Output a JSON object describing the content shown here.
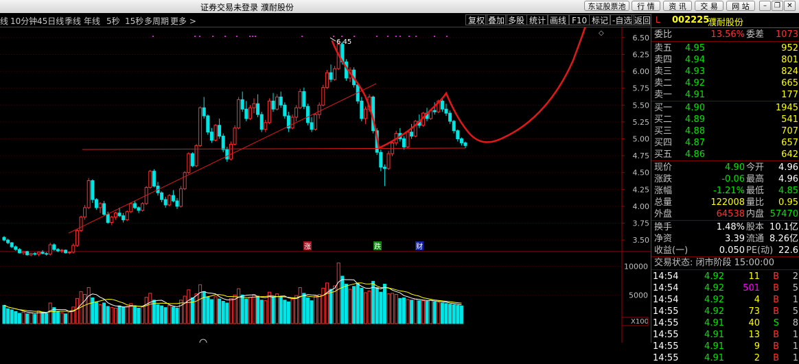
{
  "titlebar": {
    "title": "证券交易未登录  濮耐股份",
    "buttons": [
      "东证股票池",
      "行 情",
      "资 讯",
      "交 易",
      "网 站"
    ]
  },
  "toolbar": {
    "partial": "线",
    "periods": [
      "10分钟",
      "45日线",
      "季线",
      "年线",
      "5秒",
      "15秒",
      "多周期",
      "更多 >"
    ],
    "right_buttons": [
      "复权",
      "叠加",
      "多股",
      "统计",
      "画线",
      "F10",
      "标记",
      "-自选",
      "返回"
    ]
  },
  "chart_data": [
    {
      "type": "candlestick",
      "title": "",
      "y_ticks": [
        3.5,
        3.75,
        4.0,
        4.25,
        4.5,
        4.75,
        5.0,
        5.25,
        5.5,
        5.75,
        6.0,
        6.25,
        6.5
      ],
      "ylim": [
        3.4,
        6.6
      ],
      "annotations": {
        "max_label": "6.45",
        "event_markers": [
          "涨",
          "跌",
          "财"
        ]
      },
      "ohlc": [
        [
          3.54,
          3.56,
          3.48,
          3.5
        ],
        [
          3.5,
          3.52,
          3.44,
          3.46
        ],
        [
          3.46,
          3.47,
          3.38,
          3.4
        ],
        [
          3.4,
          3.42,
          3.34,
          3.36
        ],
        [
          3.36,
          3.38,
          3.3,
          3.31
        ],
        [
          3.31,
          3.34,
          3.28,
          3.33
        ],
        [
          3.33,
          3.34,
          3.27,
          3.28
        ],
        [
          3.28,
          3.31,
          3.26,
          3.3
        ],
        [
          3.3,
          3.32,
          3.27,
          3.29
        ],
        [
          3.29,
          3.33,
          3.26,
          3.32
        ],
        [
          3.32,
          3.35,
          3.29,
          3.3
        ],
        [
          3.3,
          3.32,
          3.27,
          3.29
        ],
        [
          3.29,
          3.46,
          3.27,
          3.43
        ],
        [
          3.43,
          3.45,
          3.34,
          3.36
        ],
        [
          3.36,
          3.38,
          3.32,
          3.34
        ],
        [
          3.34,
          3.37,
          3.31,
          3.35
        ],
        [
          3.35,
          3.36,
          3.3,
          3.31
        ],
        [
          3.31,
          3.33,
          3.29,
          3.32
        ],
        [
          3.32,
          3.45,
          3.3,
          3.42
        ],
        [
          3.42,
          3.66,
          3.4,
          3.64
        ],
        [
          3.64,
          3.86,
          3.62,
          3.84
        ],
        [
          3.84,
          4.02,
          3.8,
          3.98
        ],
        [
          3.98,
          4.42,
          3.96,
          4.38
        ],
        [
          4.38,
          4.4,
          4.05,
          4.1
        ],
        [
          4.1,
          4.12,
          3.95,
          3.98
        ],
        [
          3.98,
          4.06,
          3.9,
          4.04
        ],
        [
          4.04,
          4.08,
          3.86,
          3.88
        ],
        [
          3.88,
          3.92,
          3.74,
          3.76
        ],
        [
          3.76,
          3.86,
          3.72,
          3.84
        ],
        [
          3.84,
          3.92,
          3.8,
          3.9
        ],
        [
          3.9,
          3.98,
          3.84,
          3.86
        ],
        [
          3.86,
          3.9,
          3.76,
          3.8
        ],
        [
          3.8,
          3.94,
          3.78,
          3.92
        ],
        [
          3.92,
          4.06,
          3.9,
          4.04
        ],
        [
          4.04,
          4.08,
          3.96,
          3.98
        ],
        [
          3.98,
          4.0,
          3.9,
          3.94
        ],
        [
          3.94,
          4.06,
          3.92,
          4.04
        ],
        [
          4.04,
          4.3,
          4.02,
          4.28
        ],
        [
          4.28,
          4.54,
          4.26,
          4.52
        ],
        [
          4.52,
          4.55,
          4.28,
          4.3
        ],
        [
          4.3,
          4.36,
          4.16,
          4.2
        ],
        [
          4.2,
          4.22,
          4.06,
          4.1
        ],
        [
          4.1,
          4.14,
          3.98,
          4.02
        ],
        [
          4.02,
          4.18,
          4.0,
          4.16
        ],
        [
          4.16,
          4.24,
          4.06,
          4.08
        ],
        [
          4.08,
          4.12,
          3.96,
          4.0
        ],
        [
          4.0,
          4.3,
          3.98,
          4.26
        ],
        [
          4.26,
          4.52,
          4.24,
          4.5
        ],
        [
          4.5,
          4.8,
          4.48,
          4.78
        ],
        [
          4.78,
          4.8,
          4.58,
          4.6
        ],
        [
          4.6,
          4.92,
          4.58,
          4.9
        ],
        [
          4.9,
          5.48,
          4.88,
          5.46
        ],
        [
          5.46,
          5.62,
          5.3,
          5.34
        ],
        [
          5.34,
          5.36,
          5.06,
          5.1
        ],
        [
          5.1,
          5.16,
          4.94,
          4.98
        ],
        [
          4.98,
          5.22,
          4.96,
          5.2
        ],
        [
          5.2,
          5.3,
          5.0,
          5.04
        ],
        [
          5.04,
          5.08,
          4.8,
          4.84
        ],
        [
          4.84,
          4.88,
          4.66,
          4.7
        ],
        [
          4.7,
          4.96,
          4.68,
          4.92
        ],
        [
          4.92,
          5.2,
          4.9,
          5.16
        ],
        [
          5.16,
          5.62,
          5.14,
          5.58
        ],
        [
          5.58,
          5.7,
          5.4,
          5.44
        ],
        [
          5.44,
          5.56,
          5.26,
          5.3
        ],
        [
          5.3,
          5.5,
          5.28,
          5.46
        ],
        [
          5.46,
          5.6,
          5.38,
          5.52
        ],
        [
          5.52,
          5.66,
          5.32,
          5.36
        ],
        [
          5.36,
          5.4,
          5.1,
          5.14
        ],
        [
          5.14,
          5.28,
          5.1,
          5.24
        ],
        [
          5.24,
          5.6,
          5.22,
          5.56
        ],
        [
          5.56,
          5.68,
          5.4,
          5.44
        ],
        [
          5.44,
          5.66,
          5.42,
          5.62
        ],
        [
          5.62,
          5.7,
          5.46,
          5.5
        ],
        [
          5.5,
          5.54,
          5.3,
          5.34
        ],
        [
          5.34,
          5.4,
          5.1,
          5.16
        ],
        [
          5.16,
          5.36,
          5.14,
          5.32
        ],
        [
          5.32,
          5.5,
          5.26,
          5.46
        ],
        [
          5.46,
          5.74,
          5.44,
          5.7
        ],
        [
          5.7,
          5.76,
          5.44,
          5.48
        ],
        [
          5.48,
          5.52,
          5.2,
          5.24
        ],
        [
          5.24,
          5.32,
          5.1,
          5.14
        ],
        [
          5.14,
          5.38,
          5.12,
          5.36
        ],
        [
          5.36,
          5.54,
          5.3,
          5.5
        ],
        [
          5.5,
          5.8,
          5.48,
          5.76
        ],
        [
          5.76,
          6.02,
          5.74,
          5.98
        ],
        [
          5.98,
          6.1,
          5.84,
          5.88
        ],
        [
          5.88,
          6.08,
          5.86,
          6.04
        ],
        [
          6.04,
          6.46,
          6.02,
          6.4
        ],
        [
          6.4,
          6.44,
          6.1,
          6.14
        ],
        [
          6.14,
          6.18,
          5.86,
          5.9
        ],
        [
          5.9,
          6.06,
          5.84,
          6.02
        ],
        [
          6.02,
          6.06,
          5.76,
          5.8
        ],
        [
          5.8,
          5.84,
          5.52,
          5.56
        ],
        [
          5.56,
          5.62,
          5.26,
          5.3
        ],
        [
          5.3,
          5.48,
          5.22,
          5.44
        ],
        [
          5.44,
          5.66,
          5.4,
          5.62
        ],
        [
          5.62,
          5.64,
          5.08,
          5.12
        ],
        [
          5.12,
          5.16,
          4.76,
          4.8
        ],
        [
          4.8,
          4.84,
          4.52,
          4.58
        ],
        [
          4.58,
          4.62,
          4.3,
          4.56
        ],
        [
          4.56,
          4.82,
          4.54,
          4.78
        ],
        [
          4.78,
          4.98,
          4.74,
          4.94
        ],
        [
          4.94,
          5.12,
          4.9,
          5.08
        ],
        [
          5.08,
          5.16,
          4.96,
          5.0
        ],
        [
          5.0,
          5.04,
          4.84,
          4.88
        ],
        [
          4.88,
          5.12,
          4.86,
          5.1
        ],
        [
          5.1,
          5.22,
          5.0,
          5.04
        ],
        [
          5.04,
          5.28,
          5.02,
          5.26
        ],
        [
          5.26,
          5.36,
          5.16,
          5.2
        ],
        [
          5.2,
          5.4,
          5.18,
          5.38
        ],
        [
          5.38,
          5.46,
          5.26,
          5.3
        ],
        [
          5.3,
          5.44,
          5.28,
          5.42
        ],
        [
          5.42,
          5.54,
          5.36,
          5.4
        ],
        [
          5.4,
          5.58,
          5.38,
          5.56
        ],
        [
          5.56,
          5.6,
          5.4,
          5.44
        ],
        [
          5.44,
          5.52,
          5.34,
          5.38
        ],
        [
          5.38,
          5.42,
          5.22,
          5.26
        ],
        [
          5.26,
          5.28,
          5.08,
          5.12
        ],
        [
          5.12,
          5.14,
          4.96,
          5.0
        ],
        [
          5.0,
          5.02,
          4.9,
          4.94
        ],
        [
          4.94,
          4.96,
          4.86,
          4.9
        ]
      ],
      "volume_y_ticks": [
        5000,
        10000
      ],
      "volume_multiplier": "X100",
      "volume": [
        3200,
        2600,
        2400,
        2100,
        1800,
        2000,
        1700,
        1900,
        1600,
        2200,
        2000,
        1800,
        3600,
        2800,
        2100,
        1900,
        1700,
        2000,
        2900,
        4400,
        5600,
        5100,
        6300,
        4500,
        3800,
        3300,
        3600,
        3000,
        2800,
        2700,
        3100,
        2900,
        3000,
        3500,
        3100,
        2700,
        2900,
        4600,
        5300,
        4100,
        3300,
        3100,
        2800,
        3200,
        2900,
        2700,
        4100,
        4800,
        5900,
        4500,
        5200,
        6800,
        5600,
        4700,
        4200,
        4700,
        4300,
        3900,
        3600,
        4400,
        5000,
        6100,
        5000,
        4300,
        4600,
        5100,
        4800,
        4100,
        4000,
        5500,
        4700,
        5200,
        4600,
        4100,
        3800,
        4300,
        4900,
        6300,
        5300,
        4500,
        4000,
        4800,
        5100,
        6200,
        7100,
        6000,
        6600,
        10600,
        8300,
        6900,
        6000,
        6500,
        7000,
        6200,
        5400,
        5700,
        7400,
        6300,
        5500,
        6900,
        5200,
        5300,
        5100,
        4400,
        4500,
        4200,
        4100,
        4300,
        4000,
        4000,
        3900,
        4100,
        3800,
        3700,
        3600,
        3500,
        3400,
        3300,
        3200,
        3100
      ]
    }
  ],
  "quote_panel": {
    "header": {
      "code": "002225",
      "name": "濮耐股份",
      "mark": "L"
    },
    "weibi": {
      "label": "委比",
      "value": "13.56%",
      "label2": "委差",
      "value2": "1073"
    },
    "sell": [
      {
        "label": "卖五",
        "price": "4.95",
        "vol": "952"
      },
      {
        "label": "卖四",
        "price": "4.94",
        "vol": "801"
      },
      {
        "label": "卖三",
        "price": "4.93",
        "vol": "824"
      },
      {
        "label": "卖二",
        "price": "4.92",
        "vol": "665"
      },
      {
        "label": "卖一",
        "price": "4.91",
        "vol": "177"
      }
    ],
    "buy": [
      {
        "label": "买一",
        "price": "4.90",
        "vol": "1945"
      },
      {
        "label": "买二",
        "price": "4.89",
        "vol": "541"
      },
      {
        "label": "买三",
        "price": "4.88",
        "vol": "707"
      },
      {
        "label": "买四",
        "price": "4.87",
        "vol": "657"
      },
      {
        "label": "买五",
        "price": "4.86",
        "vol": "642"
      }
    ],
    "stats": [
      {
        "l1": "现价",
        "v1": "4.90",
        "l2": "今开",
        "v2": "4.96",
        "c1": "green",
        "c2": "white"
      },
      {
        "l1": "涨跌",
        "v1": "-0.06",
        "l2": "最高",
        "v2": "4.96",
        "c1": "green",
        "c2": "white"
      },
      {
        "l1": "涨幅",
        "v1": "-1.21%",
        "l2": "最低",
        "v2": "4.85",
        "c1": "green",
        "c2": "green"
      },
      {
        "l1": "总量",
        "v1": "122008",
        "l2": "量比",
        "v2": "0.95",
        "c1": "yel",
        "c2": "yel"
      },
      {
        "l1": "外盘",
        "v1": "64538",
        "l2": "内盘",
        "v2": "57470",
        "c1": "red",
        "c2": "green"
      }
    ],
    "fund": [
      {
        "l1": "换手",
        "v1": "1.48%",
        "l2": "股本",
        "v2": "10.1亿"
      },
      {
        "l1": "净资",
        "v1": "3.39",
        "l2": "流通",
        "v2": "8.26亿"
      },
      {
        "l1": "收益(一)",
        "v1": "0.050",
        "l2": "PE(动)",
        "v2": "22.6"
      }
    ],
    "trade_status": "交易状态: 闭市阶段 15:00:00",
    "ticks": [
      {
        "time": "14:54",
        "price": "4.92",
        "vol": "11",
        "bs": "B",
        "n": "2",
        "pc": "green",
        "vc": "yel",
        "bc": "red"
      },
      {
        "time": "14:54",
        "price": "4.92",
        "vol": "501",
        "bs": "B",
        "n": "5",
        "pc": "green",
        "vc": "mag",
        "bc": "red"
      },
      {
        "time": "14:54",
        "price": "4.92",
        "vol": "4",
        "bs": "B",
        "n": "1",
        "pc": "green",
        "vc": "yel",
        "bc": "red"
      },
      {
        "time": "14:55",
        "price": "4.92",
        "vol": "73",
        "bs": "B",
        "n": "5",
        "pc": "green",
        "vc": "yel",
        "bc": "red"
      },
      {
        "time": "14:55",
        "price": "4.91",
        "vol": "40",
        "bs": "S",
        "n": "8",
        "pc": "green",
        "vc": "yel",
        "bc": "green"
      },
      {
        "time": "14:55",
        "price": "4.91",
        "vol": "13",
        "bs": "B",
        "n": "1",
        "pc": "green",
        "vc": "yel",
        "bc": "red"
      },
      {
        "time": "14:55",
        "price": "4.91",
        "vol": "9",
        "bs": "B",
        "n": "1",
        "pc": "green",
        "vc": "yel",
        "bc": "red"
      },
      {
        "time": "14:55",
        "price": "4.91",
        "vol": "2",
        "bs": "B",
        "n": "1",
        "pc": "green",
        "vc": "yel",
        "bc": "red"
      }
    ]
  },
  "colors": {
    "up": "#ff3232",
    "down": "#00e6e6",
    "bg": "#000000",
    "drawing": "#e01818"
  }
}
